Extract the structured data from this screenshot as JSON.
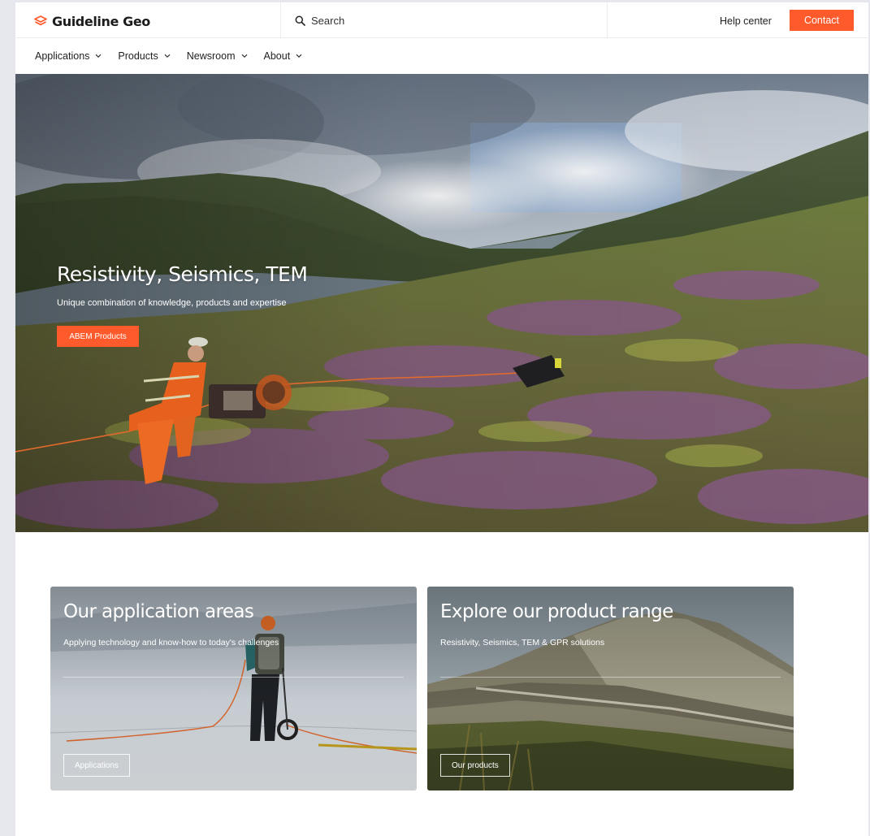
{
  "header": {
    "brand": "Guideline Geo",
    "search_placeholder": "Search",
    "help_label": "Help center",
    "contact_label": "Contact"
  },
  "nav": {
    "items": [
      {
        "label": "Applications"
      },
      {
        "label": "Products"
      },
      {
        "label": "Newsroom"
      },
      {
        "label": "About"
      }
    ]
  },
  "hero": {
    "title": "Resistivity, Seismics, TEM",
    "subtitle": "Unique combination of knowledge, products and expertise",
    "button_label": "ABEM Products"
  },
  "cards": [
    {
      "title": "Our application areas",
      "subtitle": "Applying technology and know-how to today's challenges",
      "button_label": "Applications"
    },
    {
      "title": "Explore our product range",
      "subtitle": "Resistivity, Seismics, TEM & GPR solutions",
      "button_label": "Our products"
    }
  ],
  "colors": {
    "accent": "#ff5a2b",
    "background": "#e6e7ec"
  },
  "icons": [
    "logo-stack-icon",
    "search-icon",
    "chevron-down-icon"
  ]
}
